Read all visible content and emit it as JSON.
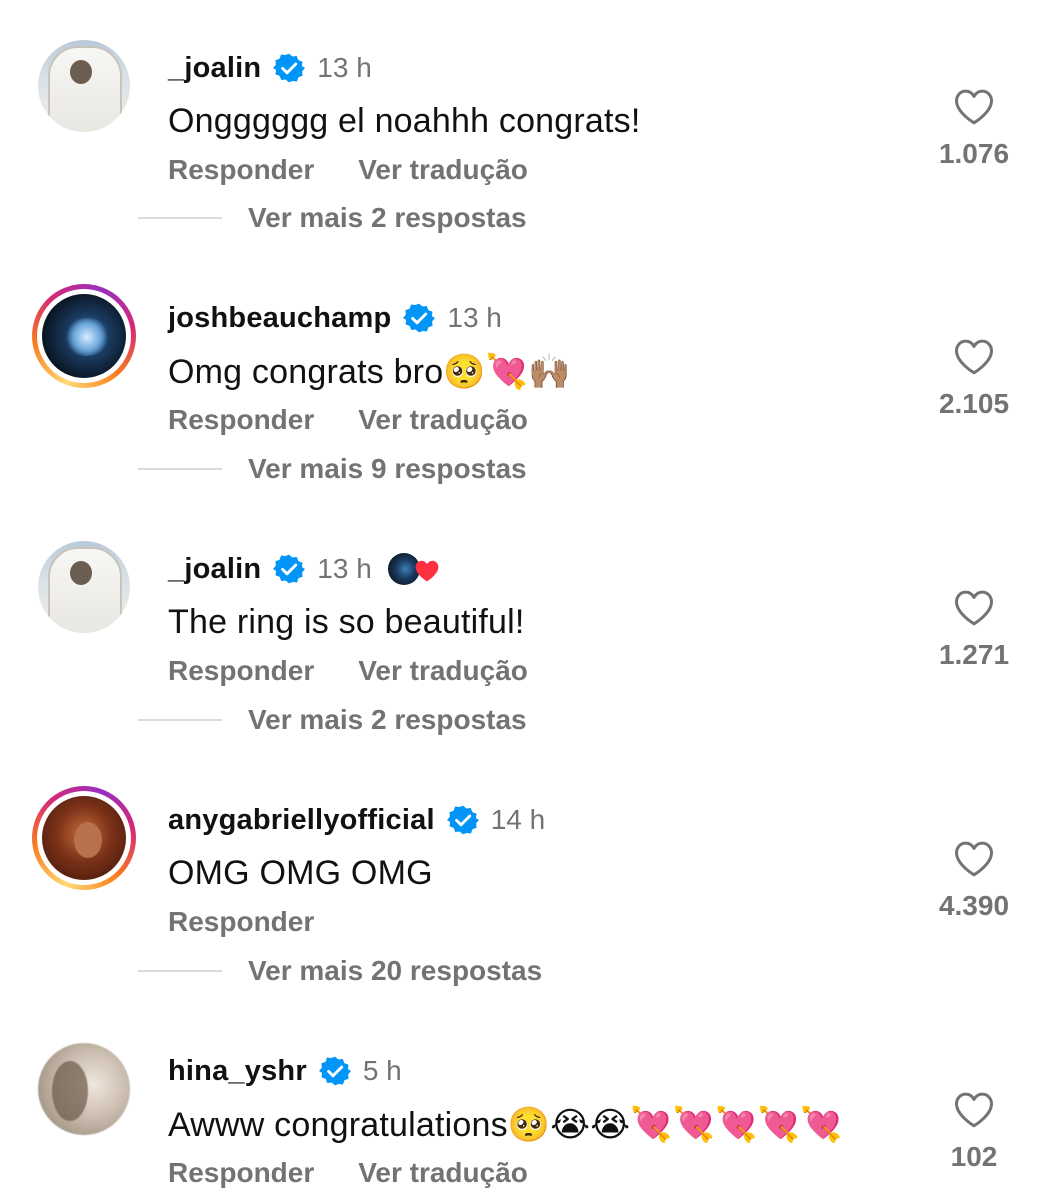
{
  "comments": [
    {
      "username": "_joalin",
      "time": "13 h",
      "text": "Ongggggg el noahhh congrats!",
      "actions": {
        "reply": "Responder",
        "translate": "Ver tradução"
      },
      "likes": "1.076",
      "more_replies": "Ver mais 2 respostas"
    },
    {
      "username": "joshbeauchamp",
      "time": "13 h",
      "text": "Omg congrats bro🥺💘🙌🏽",
      "actions": {
        "reply": "Responder",
        "translate": "Ver tradução"
      },
      "likes": "2.105",
      "more_replies": "Ver mais 9 respostas"
    },
    {
      "username": "_joalin",
      "time": "13 h",
      "text": "The ring is so beautiful!",
      "actions": {
        "reply": "Responder",
        "translate": "Ver tradução"
      },
      "likes": "1.271",
      "more_replies": "Ver mais 2 respostas"
    },
    {
      "username": "anygabriellyofficial",
      "time": "14 h",
      "text": "OMG OMG OMG",
      "actions": {
        "reply": "Responder"
      },
      "likes": "4.390",
      "more_replies": "Ver mais 20 respostas"
    },
    {
      "username": "hina_yshr",
      "time": "5 h",
      "text": "Awww congratulations🥺😭😭💘💘💘💘💘",
      "actions": {
        "reply": "Responder",
        "translate": "Ver tradução"
      },
      "likes": "102"
    }
  ],
  "colors": {
    "verified_blue": "#0095f6",
    "secondary_text": "#737373",
    "liked_heart_red": "#ff3040"
  },
  "icons": {
    "verified": "verified-badge-icon",
    "like": "heart-outline-icon",
    "liked_by_author": "author-liked-heart-icon"
  }
}
